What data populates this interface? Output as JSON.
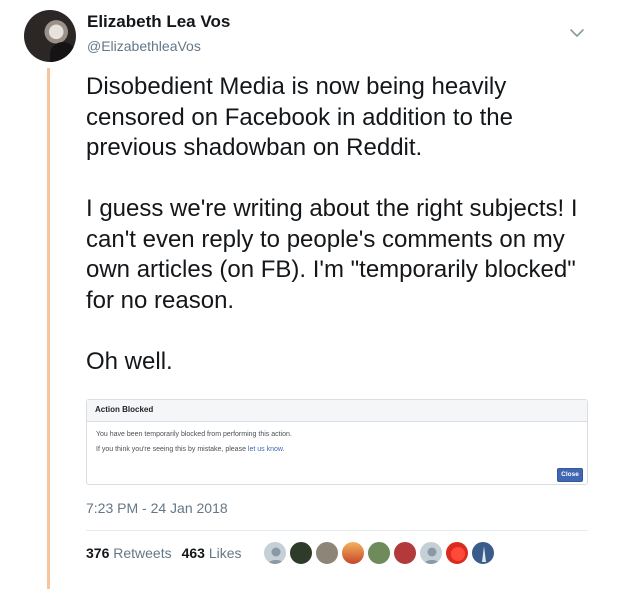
{
  "user": {
    "display_name": "Elizabeth Lea Vos",
    "handle": "@ElizabethleaVos"
  },
  "tweet": {
    "paragraphs": [
      "Disobedient Media is now being heavily censored on Facebook in addition to the previous shadowban on Reddit.",
      "I guess we're writing about the right subjects! I can't even reply to people's comments on my own articles (on FB). I'm \"temporarily blocked\" for no reason.",
      "Oh well."
    ],
    "timestamp": "7:23 PM - 24 Jan 2018"
  },
  "embedded_image": {
    "title": "Action Blocked",
    "line1": "You have been temporarily blocked from performing this action.",
    "line2_prefix": "If you think you're seeing this by mistake, please ",
    "line2_link": "let us know",
    "line2_suffix": ".",
    "button_label": "Close"
  },
  "stats": {
    "retweets_count": "376",
    "retweets_label": "Retweets",
    "likes_count": "463",
    "likes_label": "Likes"
  },
  "likers": [
    {
      "icon": "default-avatar-icon",
      "color": "#c4cfd6"
    },
    {
      "icon": "tree-avatar-icon",
      "color": "#2f3b2a"
    },
    {
      "icon": "building-avatar-icon",
      "color": "#8d8577"
    },
    {
      "icon": "sunset-avatar-icon",
      "color": "#d9643a"
    },
    {
      "icon": "landscape-avatar-icon",
      "color": "#6f8b5c"
    },
    {
      "icon": "sign-avatar-icon",
      "color": "#b23a3a"
    },
    {
      "icon": "default-avatar-icon",
      "color": "#c4cfd6"
    },
    {
      "icon": "red-badge-avatar-icon",
      "color": "#d92b1e"
    },
    {
      "icon": "monument-avatar-icon",
      "color": "#3a5c8a"
    }
  ],
  "colors": {
    "thread_line": "#f6c59d",
    "secondary_text": "#657786",
    "facebook_blue": "#4267b2"
  }
}
